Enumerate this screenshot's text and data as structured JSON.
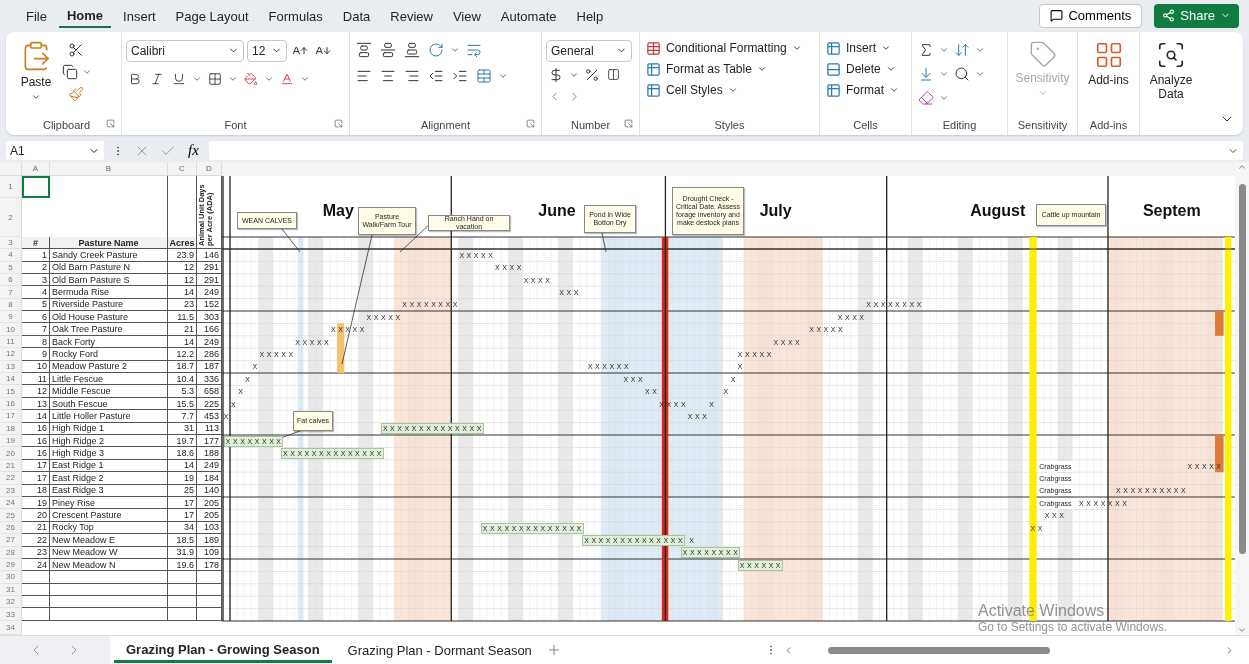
{
  "menu_tabs": [
    {
      "label": "File",
      "selected": false
    },
    {
      "label": "Home",
      "selected": true
    },
    {
      "label": "Insert",
      "selected": false
    },
    {
      "label": "Page Layout",
      "selected": false
    },
    {
      "label": "Formulas",
      "selected": false
    },
    {
      "label": "Data",
      "selected": false
    },
    {
      "label": "Review",
      "selected": false
    },
    {
      "label": "View",
      "selected": false
    },
    {
      "label": "Automate",
      "selected": false
    },
    {
      "label": "Help",
      "selected": false
    }
  ],
  "header_buttons": {
    "comments": "Comments",
    "share": "Share"
  },
  "ribbon": {
    "clipboard": {
      "paste": "Paste",
      "label": "Clipboard"
    },
    "font": {
      "font_name": "Calibri",
      "font_size": "12",
      "label": "Font"
    },
    "alignment": {
      "label": "Alignment"
    },
    "number": {
      "format": "General",
      "label": "Number"
    },
    "styles": {
      "items": [
        "Conditional Formatting",
        "Format as Table",
        "Cell Styles"
      ],
      "label": "Styles"
    },
    "cells": {
      "items": [
        "Insert",
        "Delete",
        "Format"
      ],
      "label": "Cells"
    },
    "editing": {
      "label": "Editing"
    },
    "sensitivity": {
      "button": "Sensitivity",
      "label": "Sensitivity",
      "disabled": true
    },
    "add_ins": {
      "button": "Add-ins",
      "label": "Add-ins"
    },
    "analyze_data": {
      "button": "Analyze Data"
    }
  },
  "formula_bar": {
    "name_box": "A1",
    "fx": "fx"
  },
  "sheet": {
    "column_headers": [
      "A",
      "B",
      "C",
      "D"
    ],
    "row_numbers": [
      "1",
      "2",
      "3",
      "4",
      "5",
      "6",
      "7",
      "8",
      "9",
      "10",
      "11",
      "12",
      "13",
      "14",
      "15",
      "16",
      "17",
      "18",
      "19",
      "20",
      "21",
      "22",
      "23",
      "24",
      "25",
      "26",
      "27",
      "28",
      "29",
      "30",
      "31",
      "32",
      "33",
      "34"
    ],
    "table_headers": [
      "#",
      "Pasture Name",
      "Acres",
      "Animal Unit Days per Acre (ADA)"
    ],
    "rows": [
      {
        "num": "1",
        "name": "Sandy Creek Pasture",
        "acres": "23.9",
        "ada": "146",
        "marks": [
          {
            "text": "X X X X X",
            "kind": "plain"
          }
        ]
      },
      {
        "num": "2",
        "name": "Old Barn Pasture N",
        "acres": "12",
        "ada": "291",
        "marks": [
          {
            "text": "X X X X",
            "kind": "plain"
          }
        ]
      },
      {
        "num": "3",
        "name": "Old Barn Pasture S",
        "acres": "12",
        "ada": "291",
        "marks": [
          {
            "text": "X X X X",
            "kind": "plain"
          }
        ]
      },
      {
        "num": "4",
        "name": "Bermuda Rise",
        "acres": "14",
        "ada": "249",
        "marks": [
          {
            "text": "X X X",
            "kind": "plain"
          }
        ]
      },
      {
        "num": "5",
        "name": "Riverside Pasture",
        "acres": "23",
        "ada": "152",
        "marks": [
          {
            "text": "X X X X X X X X",
            "kind": "plain"
          },
          {
            "text": "X X X X X X X X",
            "kind": "plain"
          }
        ]
      },
      {
        "num": "6",
        "name": "Old House Pasture",
        "acres": "11.5",
        "ada": "303",
        "marks": [
          {
            "text": "X X X X X",
            "kind": "plain"
          },
          {
            "text": "X X X X",
            "kind": "plain"
          }
        ]
      },
      {
        "num": "7",
        "name": "Oak Tree Pasture",
        "acres": "21",
        "ada": "166",
        "marks": [
          {
            "text": "X X X X X",
            "kind": "plain"
          },
          {
            "text": "X X X X X",
            "kind": "plain"
          }
        ]
      },
      {
        "num": "8",
        "name": "Back Forty",
        "acres": "14",
        "ada": "249",
        "marks": [
          {
            "text": "X X X X X",
            "kind": "plain"
          },
          {
            "text": "X X X X",
            "kind": "plain"
          }
        ]
      },
      {
        "num": "9",
        "name": "Rocky Ford",
        "acres": "12.2",
        "ada": "286",
        "marks": [
          {
            "text": "X X X X X",
            "kind": "plain"
          },
          {
            "text": "X X X X X",
            "kind": "plain"
          }
        ]
      },
      {
        "num": "10",
        "name": "Meadow Pasture 2",
        "acres": "18.7",
        "ada": "187",
        "marks": [
          {
            "text": "X",
            "kind": "plain"
          },
          {
            "text": "X X X X X X",
            "kind": "plain"
          },
          {
            "text": "X",
            "kind": "plain"
          }
        ]
      },
      {
        "num": "11",
        "name": "Little Fescue",
        "acres": "10.4",
        "ada": "336",
        "marks": [
          {
            "text": "X",
            "kind": "plain"
          },
          {
            "text": "X X X",
            "kind": "plain"
          },
          {
            "text": "X",
            "kind": "plain"
          }
        ]
      },
      {
        "num": "12",
        "name": "Middle Fescue",
        "acres": "5.3",
        "ada": "658",
        "marks": [
          {
            "text": "X",
            "kind": "plain"
          },
          {
            "text": "X X",
            "kind": "plain"
          },
          {
            "text": "X",
            "kind": "plain"
          }
        ]
      },
      {
        "num": "13",
        "name": "South Fescue",
        "acres": "15.5",
        "ada": "225",
        "marks": [
          {
            "text": "X",
            "kind": "plain"
          },
          {
            "text": "X X X X",
            "kind": "plain"
          },
          {
            "text": "X",
            "kind": "plain"
          }
        ]
      },
      {
        "num": "14",
        "name": "Little Holler Pasture",
        "acres": "7.7",
        "ada": "453",
        "marks": [
          {
            "text": "X",
            "kind": "plain"
          },
          {
            "text": "X X X",
            "kind": "plain"
          }
        ]
      },
      {
        "num": "16",
        "name": "High Ridge 1",
        "acres": "31",
        "ada": "113",
        "marks": [
          {
            "text": "X X X X X X X X X X X X X X",
            "kind": "boxed"
          }
        ]
      },
      {
        "num": "16",
        "name": "High Ridge 2",
        "acres": "19.7",
        "ada": "177",
        "marks": [
          {
            "text": "X X X X X X X X",
            "kind": "boxed"
          }
        ]
      },
      {
        "num": "16",
        "name": "High Ridge 3",
        "acres": "18.6",
        "ada": "188",
        "marks": [
          {
            "text": "X X X X X X X X X X X X X X",
            "kind": "boxed"
          }
        ]
      },
      {
        "num": "17",
        "name": "East Ridge 1",
        "acres": "14",
        "ada": "249",
        "marks": [
          {
            "text": "Crabgrass",
            "kind": "note"
          },
          {
            "text": "X X X X X",
            "kind": "plain"
          }
        ]
      },
      {
        "num": "17",
        "name": "East Ridge 2",
        "acres": "19",
        "ada": "184",
        "marks": [
          {
            "text": "Crabgrass",
            "kind": "note"
          }
        ]
      },
      {
        "num": "18",
        "name": "East Ridge 3",
        "acres": "25",
        "ada": "140",
        "marks": [
          {
            "text": "Crabgrass",
            "kind": "note"
          },
          {
            "text": "X X X X X X X X X X",
            "kind": "plain"
          }
        ]
      },
      {
        "num": "19",
        "name": "Piney Rise",
        "acres": "17",
        "ada": "205",
        "marks": [
          {
            "text": "Crabgrass",
            "kind": "note"
          },
          {
            "text": "X X X X X X X",
            "kind": "plain"
          }
        ]
      },
      {
        "num": "20",
        "name": "Crescent Pasture",
        "acres": "17",
        "ada": "205",
        "marks": [
          {
            "text": "X X X",
            "kind": "plain"
          }
        ]
      },
      {
        "num": "21",
        "name": "Rocky Top",
        "acres": "34",
        "ada": "103",
        "marks": [
          {
            "text": "X X X X X X X X X X X X X X",
            "kind": "boxed"
          },
          {
            "text": "X X",
            "kind": "plain"
          }
        ]
      },
      {
        "num": "22",
        "name": "New Meadow E",
        "acres": "18.5",
        "ada": "189",
        "marks": [
          {
            "text": "X X X X X X X X X X X X X X",
            "kind": "boxed"
          },
          {
            "text": "X",
            "kind": "plain"
          }
        ]
      },
      {
        "num": "23",
        "name": "New Meadow W",
        "acres": "31.9",
        "ada": "109",
        "marks": [
          {
            "text": "X X X X X X X X",
            "kind": "boxed"
          }
        ]
      },
      {
        "num": "24",
        "name": "New Meadow N",
        "acres": "19.6",
        "ada": "178",
        "marks": [
          {
            "text": "X X X X X X",
            "kind": "boxed"
          }
        ]
      }
    ],
    "months": [
      "May",
      "June",
      "July",
      "August",
      "Septem"
    ],
    "notes": [
      "WEAN CALVES",
      "Pasture Walk/Farm Tour",
      "Ranch Hand on vacation",
      "Pond in Wide Botton Dry",
      "Drought Check - Critical Date. Assess forage inventory and make destock plans",
      "Cattle up mountain",
      "Fat calves"
    ]
  },
  "sheet_tabs": [
    {
      "label": "Grazing Plan - Growing Season",
      "selected": true
    },
    {
      "label": "Grazing Plan - Dormant Season",
      "selected": false
    }
  ],
  "activation_notice": {
    "title": "Activate Windows",
    "body": "Go to Settings to activate Windows."
  }
}
